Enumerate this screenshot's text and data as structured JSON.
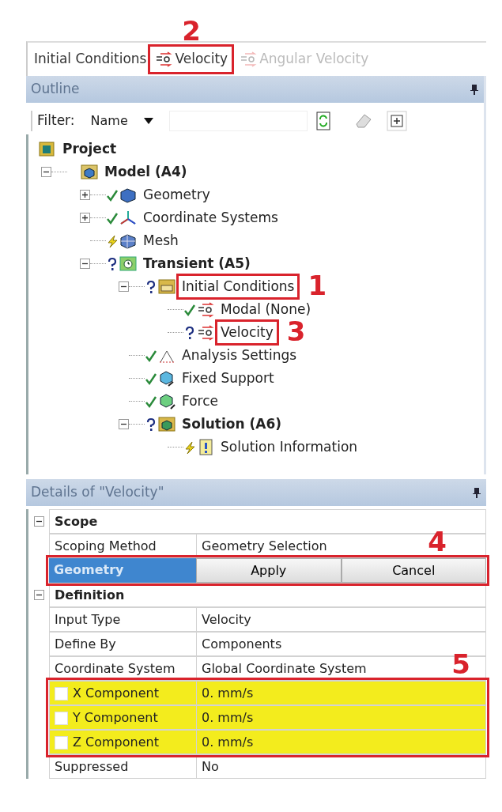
{
  "toolbar": [
    {
      "kind": "label",
      "text": "Initial Conditions"
    },
    {
      "kind": "button",
      "label": "Velocity",
      "disabled": false,
      "callout": {
        "label": "2"
      }
    },
    {
      "kind": "button",
      "label": "Angular Velocity",
      "disabled": true
    }
  ],
  "outline": {
    "title": "Outline",
    "filter": {
      "label": "Filter:",
      "value": "Name"
    },
    "tree": [
      {
        "label": "Project",
        "bold": true,
        "children": [
          {
            "label": "Model (A4)",
            "bold": true,
            "expanded": true,
            "children": [
              {
                "label": "Geometry",
                "bold": false,
                "kind": "ok",
                "expanded": false
              },
              {
                "label": "Coordinate Systems",
                "bold": false,
                "kind": "ok",
                "expanded": false
              },
              {
                "label": "Mesh",
                "bold": false,
                "kind": "pending"
              },
              {
                "label": "Transient (A5)",
                "bold": true,
                "kind": "undefined",
                "expanded": true,
                "children": [
                  {
                    "label": "Initial Conditions",
                    "bold": false,
                    "kind": "undefined",
                    "expanded": true,
                    "callout": {
                      "label": "1"
                    },
                    "children": [
                      {
                        "label": "Modal (None)",
                        "bold": false,
                        "kind": "ok"
                      },
                      {
                        "label": "Velocity",
                        "bold": false,
                        "kind": "undefined",
                        "callout": {
                          "label": "3"
                        }
                      }
                    ]
                  },
                  {
                    "label": "Analysis Settings",
                    "bold": false,
                    "kind": "ok"
                  },
                  {
                    "label": "Fixed Support",
                    "bold": false,
                    "kind": "ok"
                  },
                  {
                    "label": "Force",
                    "bold": false,
                    "kind": "ok"
                  },
                  {
                    "label": "Solution (A6)",
                    "bold": true,
                    "kind": "undefined",
                    "expanded": true,
                    "children": [
                      {
                        "label": "Solution Information",
                        "bold": false,
                        "kind": "pending"
                      }
                    ]
                  }
                ]
              }
            ]
          }
        ]
      }
    ]
  },
  "details": {
    "title": "Details of \"Velocity\"",
    "sections": [
      {
        "title": "Scope",
        "expanded": true,
        "rows": [
          {
            "kind": "property",
            "name": "Scoping Method",
            "value": "Geometry Selection"
          },
          {
            "kind": "selection",
            "name": "Geometry",
            "buttons": [
              "Apply",
              "Cancel"
            ],
            "callout": {
              "label": "4"
            }
          }
        ]
      },
      {
        "title": "Definition",
        "expanded": true,
        "rows": [
          {
            "kind": "property",
            "name": "Input Type",
            "value": "Velocity"
          },
          {
            "kind": "property",
            "name": "Define By",
            "value": "Components"
          },
          {
            "kind": "property",
            "name": "Coordinate System",
            "value": "Global Coordinate System"
          },
          {
            "kind": "group",
            "callout": {
              "label": "5"
            },
            "rows": [
              {
                "kind": "check",
                "name": "X Component",
                "value": "0. mm/s",
                "checked": false,
                "highlighted": true
              },
              {
                "kind": "check",
                "name": "Y Component",
                "value": "0. mm/s",
                "checked": false,
                "highlighted": true
              },
              {
                "kind": "check",
                "name": "Z Component",
                "value": "0. mm/s",
                "checked": false,
                "highlighted": true
              }
            ]
          },
          {
            "kind": "property",
            "name": "Suppressed",
            "value": "No"
          }
        ]
      }
    ]
  }
}
